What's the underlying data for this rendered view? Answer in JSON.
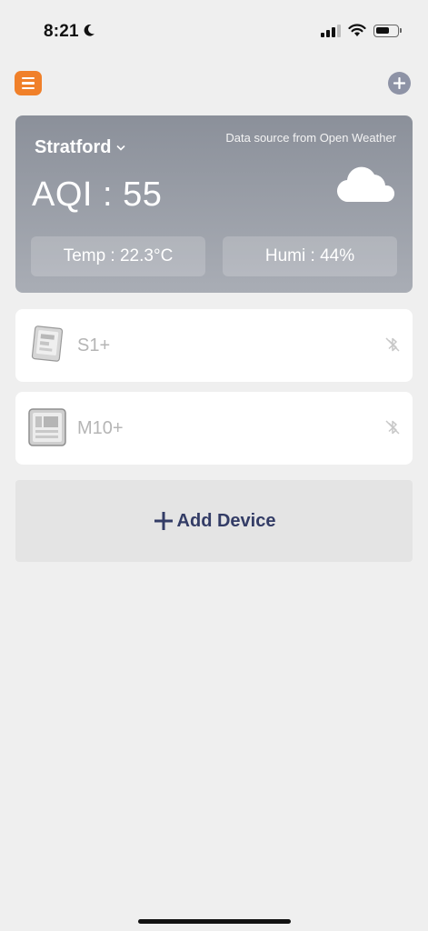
{
  "status_bar": {
    "time": "8:21",
    "moon_icon": "moon-icon",
    "signal_icon": "cellular-signal-icon",
    "wifi_icon": "wifi-icon",
    "battery_icon": "battery-icon",
    "battery_level": 0.55
  },
  "header": {
    "menu_icon": "hamburger-menu-icon",
    "add_icon": "plus-circle-icon",
    "accent_color": "#f0802a"
  },
  "weather": {
    "city": "Stratford",
    "city_dropdown_icon": "chevron-down-icon",
    "source": "Data source from Open Weather",
    "aqi": "AQI : 55",
    "condition_icon": "cloud-icon",
    "temp": "Temp : 22.3°C",
    "humi": "Humi : 44%"
  },
  "devices": [
    {
      "name": "S1+",
      "image": "s1-plus-device-icon",
      "status_icon": "bluetooth-disconnected-icon"
    },
    {
      "name": "M10+",
      "image": "m10-plus-device-icon",
      "status_icon": "bluetooth-disconnected-icon"
    }
  ],
  "add_device": {
    "label": "Add Device",
    "icon": "plus-icon",
    "color": "#333c66"
  }
}
